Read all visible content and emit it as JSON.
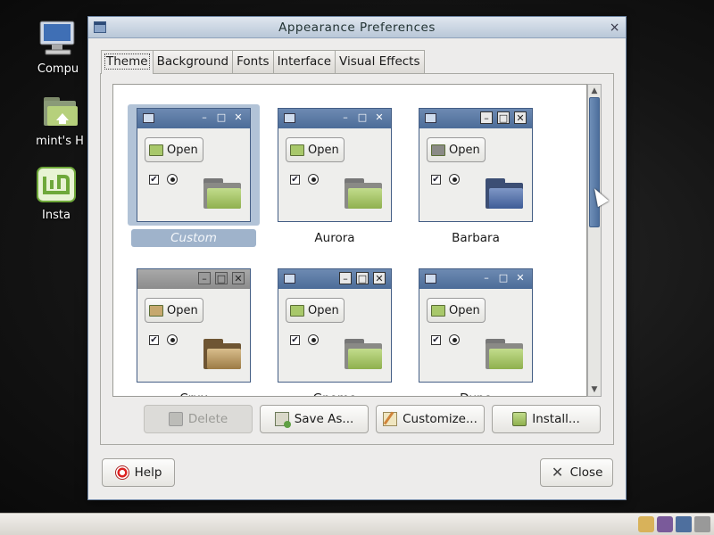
{
  "desktop": {
    "icons": [
      {
        "label": "Compu",
        "icon": "computer-icon"
      },
      {
        "label": "mint's H",
        "icon": "home-folder-icon"
      },
      {
        "label": "Insta",
        "icon": "mint-install-icon"
      }
    ]
  },
  "window": {
    "title": "Appearance Preferences",
    "close_glyph": "×"
  },
  "tabs": [
    {
      "label": "Theme",
      "active": true
    },
    {
      "label": "Background",
      "active": false
    },
    {
      "label": "Fonts",
      "active": false
    },
    {
      "label": "Interface",
      "active": false
    },
    {
      "label": "Visual Effects",
      "active": false
    }
  ],
  "themes": [
    {
      "name": "Custom",
      "selected": true,
      "open_label": "Open"
    },
    {
      "name": "Aurora",
      "selected": false,
      "open_label": "Open"
    },
    {
      "name": "Barbara",
      "selected": false,
      "open_label": "Open"
    },
    {
      "name": "Crux",
      "selected": false,
      "open_label": "Open"
    },
    {
      "name": "Gnome",
      "selected": false,
      "open_label": "Open"
    },
    {
      "name": "Dune",
      "selected": false,
      "open_label": "Open"
    }
  ],
  "actions": {
    "delete": "Delete",
    "save_as": "Save As...",
    "customize": "Customize...",
    "install": "Install..."
  },
  "footer": {
    "help": "Help",
    "close": "Close"
  },
  "colors": {
    "titlebar": "#b9c7d8",
    "selection": "#9fb3cb",
    "accent": "#4c6c98"
  }
}
